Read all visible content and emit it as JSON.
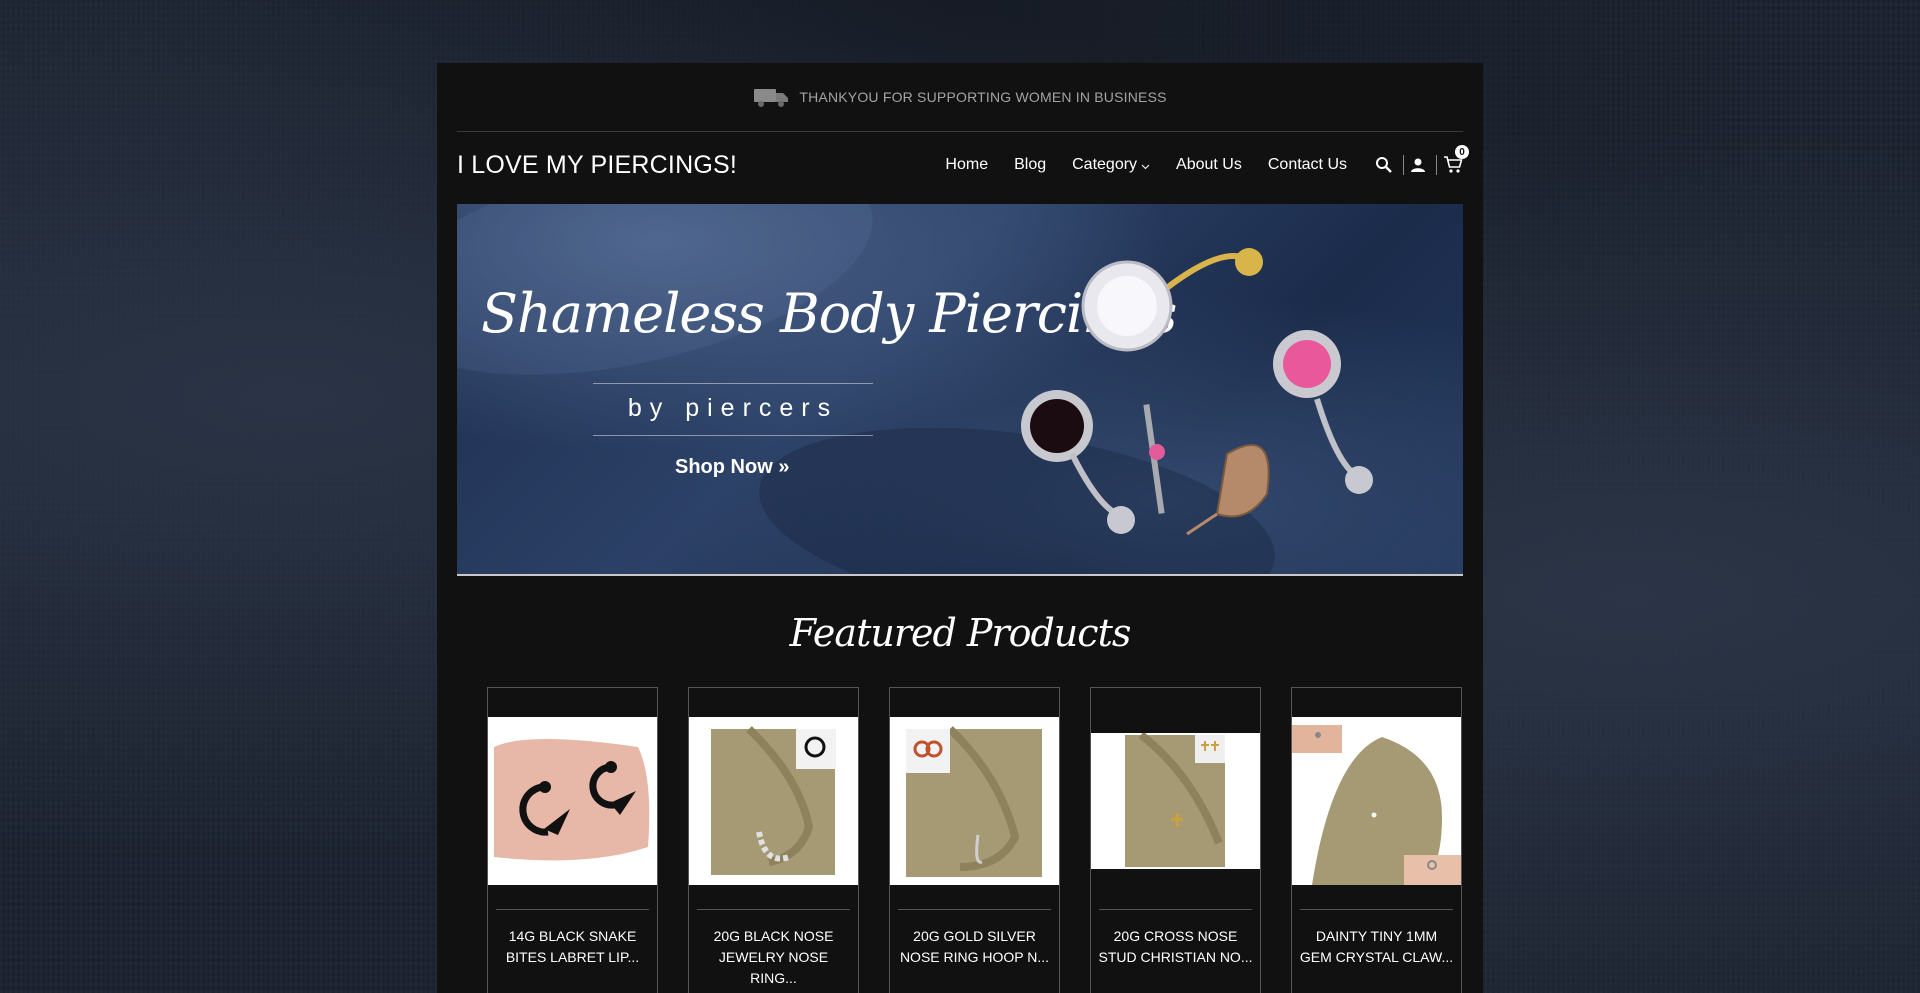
{
  "announcement": {
    "text": "THANKYOU FOR SUPPORTING WOMEN IN BUSINESS"
  },
  "header": {
    "logo": "I LOVE MY PIERCINGS!",
    "nav": [
      "Home",
      "Blog",
      "Category",
      "About Us",
      "Contact Us"
    ],
    "cart_count": "0"
  },
  "hero": {
    "title": "Shameless Body Piercings",
    "subtitle": "by piercers",
    "cta": "Shop Now »"
  },
  "featured": {
    "heading": "Featured Products",
    "products": [
      {
        "title": "14G BLACK SNAKE BITES LABRET LIP..."
      },
      {
        "title": "20G BLACK NOSE JEWELRY NOSE RING..."
      },
      {
        "title": "20G GOLD SILVER NOSE RING HOOP N..."
      },
      {
        "title": "20G CROSS NOSE STUD CHRISTIAN NO..."
      },
      {
        "title": "DAINTY TINY 1MM GEM CRYSTAL CLAW..."
      }
    ]
  },
  "colors": {
    "page_bg": "#111111",
    "text": "#ffffff",
    "announce_text": "#a3a3a3"
  },
  "icons": [
    "truck-icon",
    "chevron-down-icon",
    "search-icon",
    "user-icon",
    "cart-icon"
  ]
}
